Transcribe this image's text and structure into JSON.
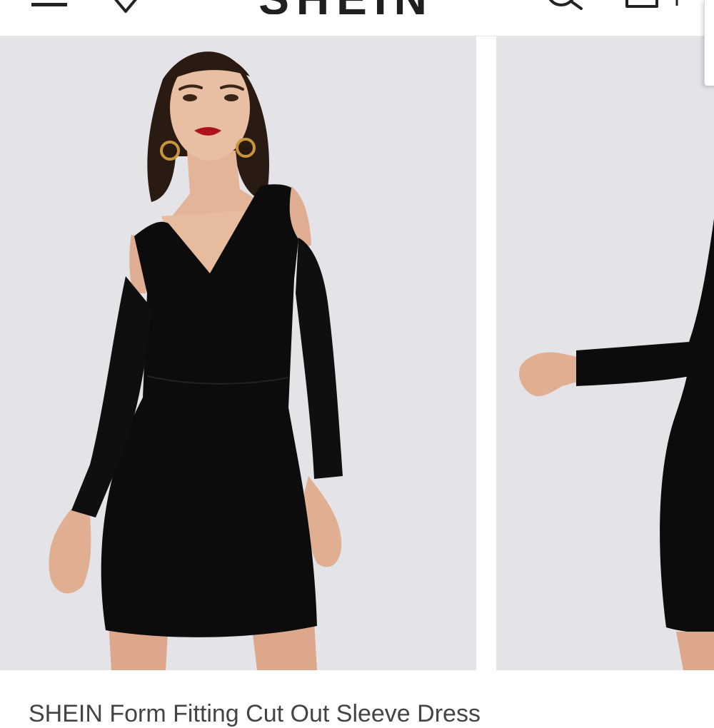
{
  "header": {
    "logo": "SHEIN",
    "icons": {
      "menu": "hamburger-menu-icon",
      "wishlist": "heart-icon",
      "search": "search-icon",
      "bag": "shopping-bag-icon"
    }
  },
  "gallery": {
    "images": [
      "product-photo-front",
      "product-photo-back"
    ]
  },
  "product": {
    "title": "SHEIN Form Fitting Cut Out Sleeve Dress"
  },
  "colors": {
    "photo_background": "#e4e3e8",
    "dress": "#0c0c0c",
    "skin": "#e3b497",
    "lips": "#b0121b",
    "logo": "#1f1f1f",
    "title_text": "#444444"
  }
}
